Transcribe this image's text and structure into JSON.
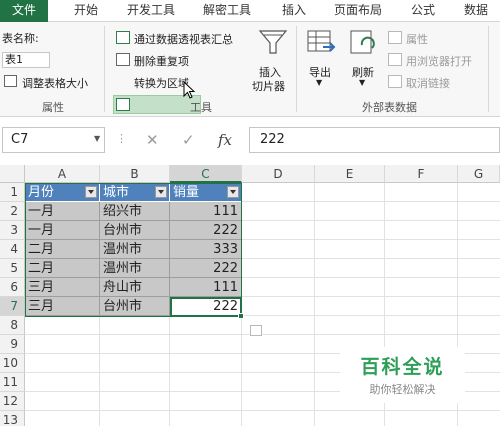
{
  "tabs": [
    "文件",
    "开始",
    "开发工具",
    "解密工具",
    "插入",
    "页面布局",
    "公式",
    "数据"
  ],
  "ribbon": {
    "table_name_label": "表名称:",
    "table_name_value": "表1",
    "resize_label": "调整表格大小",
    "properties_group": "属性",
    "pivot_label": "通过数据透视表汇总",
    "remove_dup_label": "删除重复项",
    "convert_label": "转换为区域",
    "slicer_label_1": "插入",
    "slicer_label_2": "切片器",
    "tools_group": "工具",
    "export_label": "导出",
    "refresh_label": "刷新",
    "prop_label": "属性",
    "open_browser_label": "用浏览器打开",
    "unlink_label": "取消链接",
    "external_group": "外部表数据"
  },
  "formula_bar": {
    "name_box": "C7",
    "cancel": "✕",
    "enter": "✓",
    "fx": "fx",
    "formula": "222"
  },
  "grid": {
    "columns": [
      "A",
      "B",
      "C",
      "D",
      "E",
      "F",
      "G"
    ],
    "rows": [
      "1",
      "2",
      "3",
      "4",
      "5",
      "6",
      "7",
      "8",
      "9",
      "10",
      "11",
      "12",
      "13"
    ],
    "headers": [
      "月份",
      "城市",
      "销量"
    ],
    "data": [
      [
        "一月",
        "绍兴市",
        "111"
      ],
      [
        "一月",
        "台州市",
        "222"
      ],
      [
        "二月",
        "温州市",
        "333"
      ],
      [
        "二月",
        "温州市",
        "222"
      ],
      [
        "三月",
        "舟山市",
        "111"
      ],
      [
        "三月",
        "台州市",
        "222"
      ]
    ]
  },
  "watermark": {
    "title": "百科全说",
    "subtitle": "助你轻松解决"
  },
  "colors": {
    "accent": "#217346",
    "table_header": "#4f81bd",
    "watermark": "#2e9e58"
  }
}
